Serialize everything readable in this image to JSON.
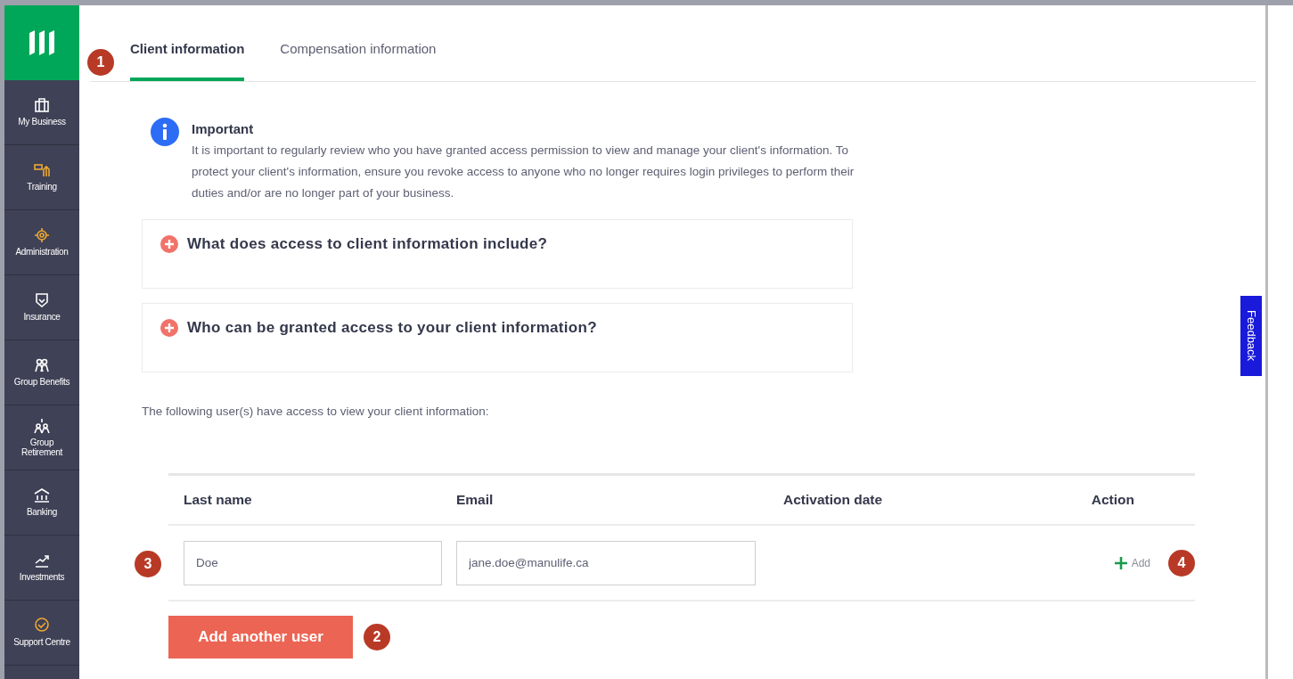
{
  "sidebar": {
    "items": [
      {
        "label": "My Business",
        "kind": "briefcase",
        "highlight": false
      },
      {
        "label": "Training",
        "kind": "training",
        "highlight": true
      },
      {
        "label": "Administration",
        "kind": "gear",
        "highlight": true
      },
      {
        "label": "Insurance",
        "kind": "shield",
        "highlight": false
      },
      {
        "label": "Group Benefits",
        "kind": "people",
        "highlight": false
      },
      {
        "label": "Group Retirement",
        "kind": "money",
        "highlight": false
      },
      {
        "label": "Banking",
        "kind": "bank",
        "highlight": false
      },
      {
        "label": "Investments",
        "kind": "chart",
        "highlight": false
      },
      {
        "label": "Support Centre",
        "kind": "support",
        "highlight": true
      }
    ]
  },
  "tabs": [
    {
      "label": "Client information",
      "selected": true,
      "callout": "1"
    },
    {
      "label": "Compensation information",
      "selected": false
    }
  ],
  "notice": {
    "title": "Important",
    "text": "It is important to regularly review who you have granted access permission to view and manage your client's information. To protect your client's information, ensure you revoke access to anyone who no longer requires login privileges to perform their duties and/or are no longer part of your business."
  },
  "accordions": [
    {
      "label": "What does access to client information include?",
      "expanded": false
    },
    {
      "label": "Who can be granted access to your client information?",
      "expanded": false
    }
  ],
  "users_intro": "The following user(s) have access to view your client information:",
  "table": {
    "columns": [
      "Last name",
      "Email",
      "Activation date",
      "Action"
    ],
    "rows": [
      {
        "callout": "3",
        "last_name": "Doe",
        "email": "jane.doe@manulife.ca",
        "action": "Add",
        "action_callout": "4"
      }
    ]
  },
  "add_button": {
    "label": "Add another user",
    "callout": "2"
  },
  "feedback": "Feedback"
}
